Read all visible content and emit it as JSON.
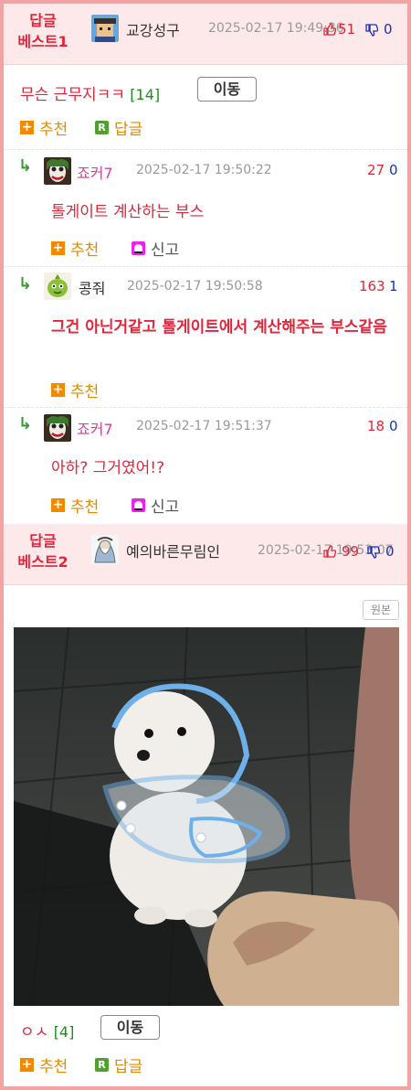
{
  "best1": {
    "tag": "답글\n베스트1",
    "nickname": "교강성구",
    "date": "2025-02-17 19:49:36",
    "up": "51",
    "down": "0",
    "title": "무슨 근무지ㅋㅋ",
    "comment_count": "[14]",
    "move_label": "이동",
    "recommend_label": "추천",
    "reply_label": "답글"
  },
  "replies": [
    {
      "nickname": "죠커7",
      "date": "2025-02-17 19:50:22",
      "up": "27",
      "down": "0",
      "text": "톨게이트 계산하는 부스",
      "recommend_label": "추천",
      "report_label": "신고"
    },
    {
      "nickname": "콩줘",
      "date": "2025-02-17 19:50:58",
      "up": "163",
      "down": "1",
      "text": "그건 아닌거같고 톨게이트에서 계산해주는 부스같음",
      "recommend_label": "추천"
    },
    {
      "nickname": "죠커7",
      "date": "2025-02-17 19:51:37",
      "up": "18",
      "down": "0",
      "text": "아하? 그거였어!?",
      "recommend_label": "추천",
      "report_label": "신고"
    }
  ],
  "best2": {
    "tag": "답글\n베스트2",
    "nickname": "예의바른무림인",
    "date": "2025-02-17 19:53:07",
    "up": "99",
    "down": "0",
    "original_label": "원본",
    "title": "ㅇㅅ",
    "comment_count": "[4]",
    "move_label": "이동",
    "recommend_label": "추천",
    "reply_label": "답글"
  },
  "colors": {
    "accent": "#e1253a",
    "header_bg": "#fde9ea",
    "border": "#f4a3a3",
    "down": "#1730c4",
    "green": "#1e8a1e"
  },
  "icons": [
    "thumbs-up-icon",
    "thumbs-down-icon",
    "plus-icon",
    "reply-r-icon",
    "report-icon",
    "reply-arrow-icon"
  ]
}
